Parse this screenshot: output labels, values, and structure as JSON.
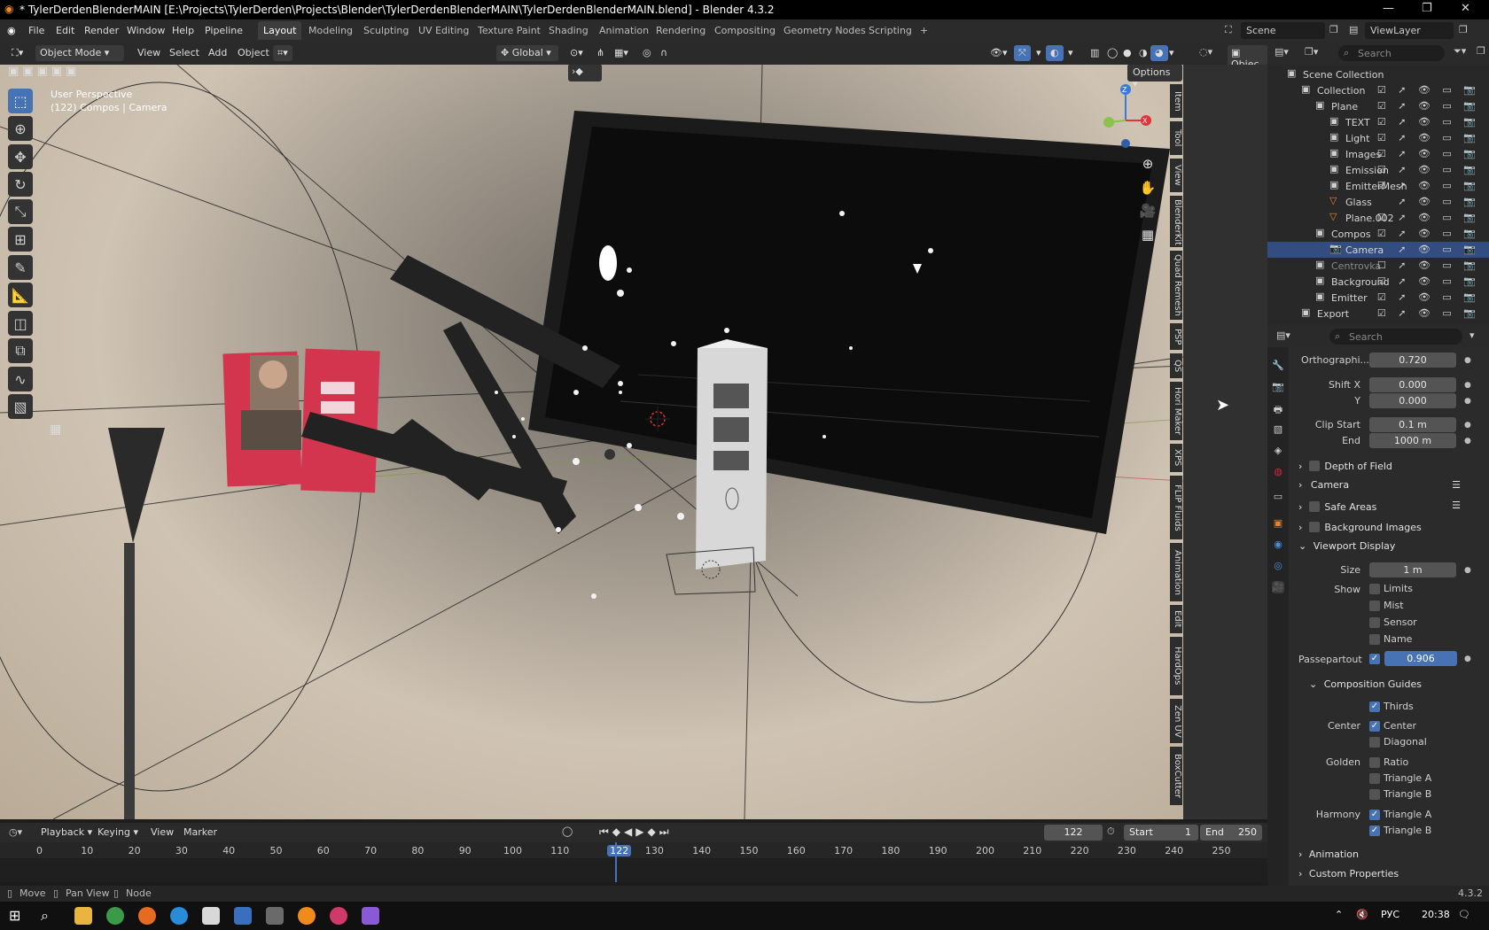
{
  "window": {
    "title": "* TylerDerdenBlenderMAIN [E:\\Projects\\TylerDerden\\Projects\\Blender\\TylerDerdenBlenderMAIN\\TylerDerdenBlenderMAIN.blend] - Blender 4.3.2",
    "controls": [
      "—",
      "❐",
      "✕"
    ]
  },
  "menu": [
    "File",
    "Edit",
    "Render",
    "Window",
    "Help",
    "Pipeline"
  ],
  "workspaces": [
    "Layout",
    "Modeling",
    "Sculpting",
    "UV Editing",
    "Texture Paint",
    "Shading",
    "Animation",
    "Rendering",
    "Compositing",
    "Geometry Nodes",
    "Scripting",
    "+"
  ],
  "active_workspace": "Layout",
  "scene": "Scene",
  "view_layer": "ViewLayer",
  "viewport_header": {
    "mode": "Object Mode",
    "menus": [
      "View",
      "Select",
      "Add",
      "Object"
    ],
    "orientation": "Global",
    "options": "Options",
    "right_label": "Objec"
  },
  "viewport": {
    "perspective": "User Perspective",
    "context": "(122) Compos | Camera",
    "gizmo": {
      "z": "Z",
      "x": "X"
    }
  },
  "sidebar_tabs": [
    "Item",
    "Tool",
    "View",
    "BlenderKit",
    "Quad Remesh",
    "PSP",
    "QS",
    "Hori Maker",
    "XPS",
    "FLIP Fluids",
    "Animation",
    "Edit",
    "HardOps",
    "Zen UV",
    "BoxCutter"
  ],
  "outliner": {
    "search_placeholder": "Search",
    "rows": [
      {
        "label": "Scene Collection",
        "indent": 0,
        "icon": "▣",
        "flags": ""
      },
      {
        "label": "Collection",
        "indent": 1,
        "icon": "▣",
        "flags": "☑ ➚ 👁 ▭ 📷"
      },
      {
        "label": "Plane",
        "indent": 2,
        "icon": "▣",
        "flags": "☑ ➚ 👁 ▭ 📷"
      },
      {
        "label": "TEXT",
        "indent": 3,
        "icon": "▣",
        "flags": "☑ ➚ 👁 ▭ 📷"
      },
      {
        "label": "Light",
        "indent": 3,
        "icon": "▣",
        "flags": "☑ ➚ 👁 ▭ 📷"
      },
      {
        "label": "Images",
        "indent": 3,
        "icon": "▣",
        "flags": "☑ ➚ 👁 ▭ 📷"
      },
      {
        "label": "Emission",
        "indent": 3,
        "icon": "▣",
        "flags": "☑ ➚ 👁 ▭ 📷"
      },
      {
        "label": "EmitterMesh",
        "indent": 3,
        "icon": "▣",
        "flags": "☑ ➚ 👁 ▭ 📷"
      },
      {
        "label": "Glass",
        "indent": 3,
        "icon": "▽",
        "flags": "➚ 👁 ▭ 📷"
      },
      {
        "label": "Plane.002",
        "indent": 3,
        "icon": "▽",
        "flags": "☑ ➚ 👁 ▭ 📷"
      },
      {
        "label": "Compos",
        "indent": 2,
        "icon": "▣",
        "flags": "☑ ➚ 👁 ▭ 📷"
      },
      {
        "label": "Camera",
        "indent": 3,
        "icon": "📷",
        "flags": "➚ 👁 ▭ 📷"
      },
      {
        "label": "Centrovka",
        "indent": 2,
        "icon": "▣",
        "flags": "☐ ➚ 👁 ▭ 📷"
      },
      {
        "label": "Background",
        "indent": 2,
        "icon": "▣",
        "flags": "☑ ➚ 👁 ▭ 📷"
      },
      {
        "label": "Emitter",
        "indent": 2,
        "icon": "▣",
        "flags": "☑ ➚ 👁 ▭ 📷"
      },
      {
        "label": "Export",
        "indent": 1,
        "icon": "▣",
        "flags": "☑ ➚ 👁 ▭ 📷"
      }
    ],
    "selected": "Camera"
  },
  "properties": {
    "search_placeholder": "Search",
    "ortho_label": "Orthographi...",
    "ortho_value": "0.720",
    "shift_label": "Shift X",
    "shift_x": "0.000",
    "y_label": "Y",
    "shift_y": "0.000",
    "clip_start_label": "Clip Start",
    "clip_start": "0.1 m",
    "clip_end_label": "End",
    "clip_end": "1000 m",
    "panels": [
      "Depth of Field",
      "Camera",
      "Safe Areas",
      "Background Images"
    ],
    "viewport_display": "Viewport Display",
    "size_label": "Size",
    "size": "1 m",
    "show_label": "Show",
    "show_items": [
      "Limits",
      "Mist",
      "Sensor",
      "Name"
    ],
    "passepartout_label": "Passepartout",
    "passepartout": "0.906",
    "composition_guides": "Composition Guides",
    "thirds": "Thirds",
    "center_label": "Center",
    "center_items": [
      "Center",
      "Diagonal"
    ],
    "golden_label": "Golden",
    "golden_items": [
      "Ratio",
      "Triangle A",
      "Triangle B"
    ],
    "harmony_label": "Harmony",
    "harmony_items": [
      "Triangle A",
      "Triangle B"
    ],
    "animation": "Animation",
    "custom_properties": "Custom Properties"
  },
  "timeline": {
    "menus": [
      "Playback",
      "Keying",
      "View",
      "Marker"
    ],
    "current_frame": "122",
    "start_label": "Start",
    "start": "1",
    "end_label": "End",
    "end": "250",
    "ticks": [
      "0",
      "10",
      "20",
      "30",
      "40",
      "50",
      "60",
      "70",
      "80",
      "90",
      "100",
      "110",
      "122",
      "130",
      "140",
      "150",
      "160",
      "170",
      "180",
      "190",
      "200",
      "210",
      "220",
      "230",
      "240",
      "250"
    ]
  },
  "status": {
    "move": "Move",
    "pan": "Pan View",
    "node": "Node",
    "version": "4.3.2"
  },
  "taskbar": {
    "lang": "РУС",
    "time": "20:38"
  },
  "colors": {
    "accent": "#4772b3",
    "selected_row": "#334d80",
    "gizmo_x": "#e0343b",
    "gizmo_y": "#8bc34a",
    "gizmo_z": "#3b7bd6"
  }
}
